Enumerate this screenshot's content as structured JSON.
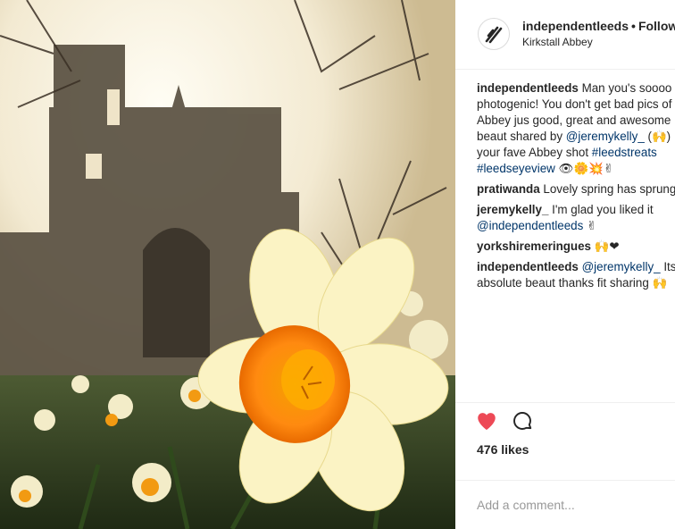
{
  "post": {
    "image_alt": "Daffodils in front of Kirkstall Abbey ruins",
    "header": {
      "username": "independentleeds",
      "separator": "•",
      "follow_label": "Follow",
      "location": "Kirkstall Abbey"
    },
    "comments": [
      {
        "handle": "independentleeds",
        "parts": [
          {
            "t": "text",
            "v": " Man you's soooo photogenic! You don't get bad pics of Abbey jus good, great and awesome beaut shared by "
          },
          {
            "t": "tag",
            "v": "@jeremykelly_"
          },
          {
            "t": "text",
            "v": " (🙌) your fave Abbey shot "
          },
          {
            "t": "tag",
            "v": "#leedstreats"
          },
          {
            "t": "text",
            "v": " "
          },
          {
            "t": "tag",
            "v": "#leedseyeview"
          },
          {
            "t": "text",
            "v": " 👁🌼💥✌"
          }
        ]
      },
      {
        "handle": "pratiwanda",
        "parts": [
          {
            "t": "text",
            "v": " Lovely spring has sprung"
          }
        ]
      },
      {
        "handle": "jeremykelly_",
        "parts": [
          {
            "t": "text",
            "v": " I'm glad you liked it "
          },
          {
            "t": "tag",
            "v": "@independentleeds"
          },
          {
            "t": "text",
            "v": " ✌"
          }
        ]
      },
      {
        "handle": "yorkshiremeringues",
        "parts": [
          {
            "t": "text",
            "v": " 🙌❤"
          }
        ]
      },
      {
        "handle": "independentleeds",
        "parts": [
          {
            "t": "text",
            "v": " "
          },
          {
            "t": "tag",
            "v": "@jeremykelly_"
          },
          {
            "t": "text",
            "v": " Its absolute beaut thanks fit sharing 🙌"
          }
        ]
      }
    ],
    "likes_label": "476 likes",
    "comment_placeholder": "Add a comment...",
    "icons": {
      "like": "heart-icon",
      "comment": "comment-bubble-icon",
      "avatar": "slash-logo-icon"
    },
    "colors": {
      "heart": "#ed4956",
      "link": "#003569",
      "muted": "#999999",
      "text": "#262626"
    }
  }
}
